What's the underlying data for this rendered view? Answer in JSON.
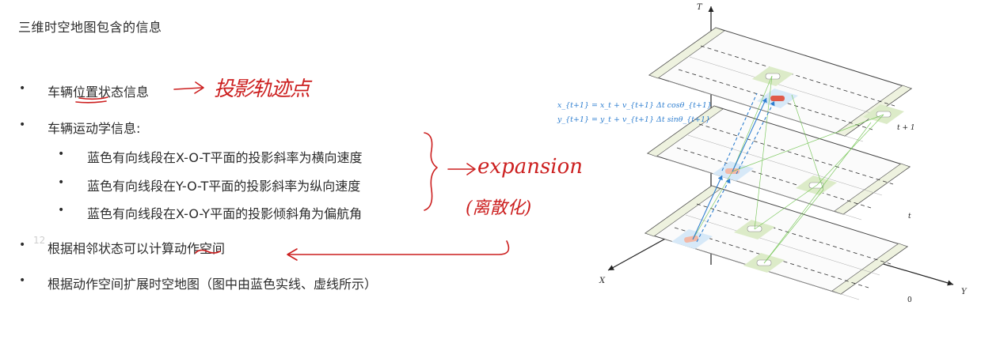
{
  "slide": {
    "title": "三维时空地图包含的信息",
    "bullets": [
      "车辆位置状态信息",
      "车辆运动学信息:",
      "根据相邻状态可以计算动作空间",
      "根据动作空间扩展时空地图（图中由蓝色实线、虚线所示）"
    ],
    "sub_bullets": [
      "蓝色有向线段在X-O-T平面的投影斜率为横向速度",
      "蓝色有向线段在Y-O-T平面的投影斜率为纵向速度",
      "蓝色有向线段在X-O-Y平面的投影倾斜角为偏航角"
    ],
    "bullet_symbol": "•",
    "ghost_number": "12"
  },
  "figure": {
    "axis_t": "T",
    "axis_x": "X",
    "axis_y": "Y",
    "origin": "0",
    "layer_t1": "t + 1",
    "layer_t": "t",
    "equation_x": "x_{t+1} = x_t + v_{t+1} Δt cosθ_{t+1}",
    "equation_y": "y_{t+1} = y_t + v_{t+1} Δt sinθ_{t+1}"
  },
  "annotations": {
    "handwritten_1": "投影轨迹点",
    "handwritten_2": "expansion",
    "handwritten_3": "(离散化)"
  },
  "colors": {
    "ink": "#cc1f1f",
    "blue": "#2f7fd0",
    "green": "#6cc24a",
    "lane": "#e9efd8"
  }
}
